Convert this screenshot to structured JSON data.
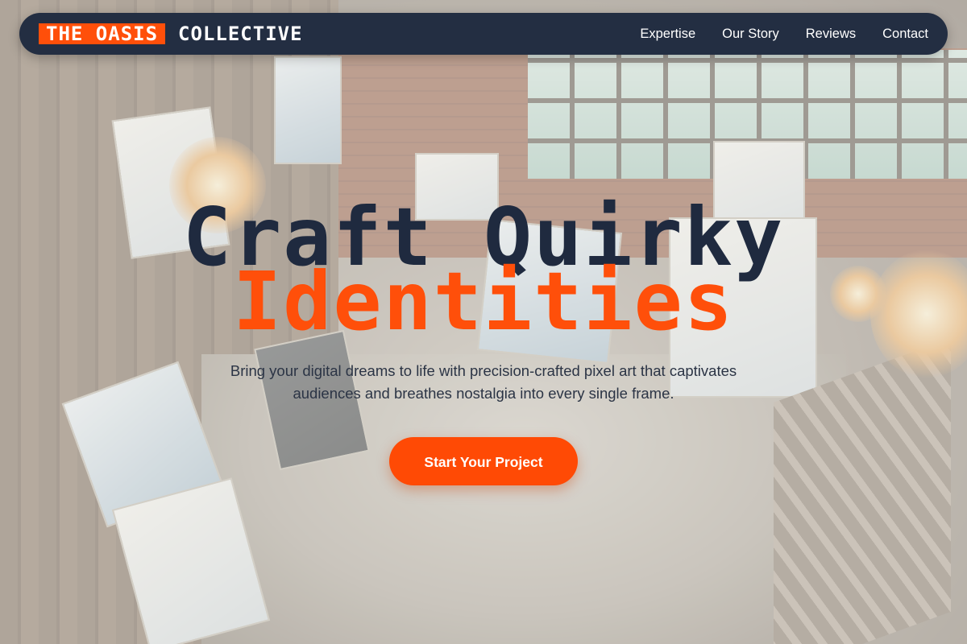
{
  "brand": {
    "highlight": "THE OASIS",
    "rest": "COLLECTIVE",
    "accent_color": "#ff4f0a",
    "navbar_color": "#232e42"
  },
  "nav": {
    "items": [
      {
        "label": "Expertise"
      },
      {
        "label": "Our Story"
      },
      {
        "label": "Reviews"
      },
      {
        "label": "Contact"
      }
    ]
  },
  "hero": {
    "line1": "Craft Quirky",
    "line2": "Identities",
    "subtitle": "Bring your digital dreams to life with precision-crafted pixel art that captivates audiences and breathes nostalgia into every single frame.",
    "cta_label": "Start Your Project",
    "title_color": "#1f2a3f"
  }
}
